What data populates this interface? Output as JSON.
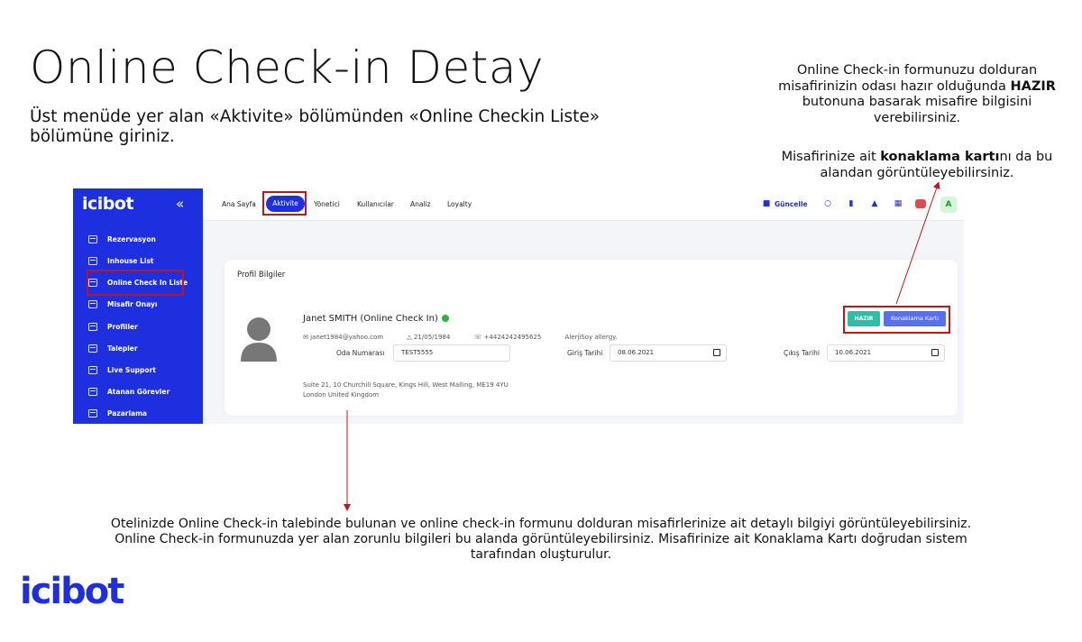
{
  "slide": {
    "title": "Online Check-in Detay",
    "subtitle": "Üst menüde yer alan «Aktivite» bölümünden «Online Checkin Liste» bölümüne giriniz.",
    "note_top_1": "Online Check-in formunuzu dolduran misafirinizin odası hazır olduğunda ",
    "note_top_bold": "HAZIR",
    "note_top_2": " butonuna basarak misafire bilgisini verebilirsiniz.",
    "note_card_1": "Misafirinize ait ",
    "note_card_bold": "konaklama kartı",
    "note_card_2": "nı da bu alandan görüntüleyebilirsiniz.",
    "note_bottom": "Otelinizde Online Check-in talebinde bulunan ve online check-in formunu dolduran misafirlerinize ait detaylı bilgiyi görüntüleyebilirsiniz. Online Check-in formunuzda yer alan zorunlu bilgileri bu alanda görüntüleyebilirsiniz. Misafirinize ait Konaklama Kartı doğrudan sistem tarafından oluşturulur.",
    "logo": "icibot"
  },
  "sidebar": {
    "logo": "icibot",
    "collapse": "«",
    "items": [
      {
        "label": "Rezervasyon"
      },
      {
        "label": "Inhouse List"
      },
      {
        "label": "Online Check In Liste"
      },
      {
        "label": "Misafir Onayı"
      },
      {
        "label": "Profiller"
      },
      {
        "label": "Talepler"
      },
      {
        "label": "Live Support"
      },
      {
        "label": "Atanan Görevler"
      },
      {
        "label": "Pazarlama"
      }
    ]
  },
  "topnav": {
    "items": [
      "Ana Sayfa",
      "Aktivite",
      "Yönetici",
      "Kullanıcılar",
      "Analiz",
      "Loyalty"
    ],
    "update_label": "Güncelle",
    "avatar_letter": "A"
  },
  "card": {
    "title": "Profil Bilgiler",
    "guest_name": "Janet SMITH (Online Check In)",
    "email": "janet1984@yahoo.com",
    "birth_date": "21/05/1984",
    "phone": "+4424242495625",
    "allergy": "AlerjiSoy allergy.",
    "room_label": "Oda Numarası",
    "room_value": "TEST5555",
    "checkin_label": "Giriş Tarihi",
    "checkin_value": "08.06.2021",
    "checkout_label": "Çıkış Tarihi",
    "checkout_value": "10.06.2021",
    "address_line1": "Suite 21, 10 Churchill Square, Kings Hill, West Malling, ME19 4YU",
    "address_line2": "London United Kingdom",
    "ready_button": "HAZIR",
    "card_button": "Konaklama Kartı"
  },
  "colors": {
    "brand_blue": "#1e2fe0",
    "highlight_red": "#c0161a",
    "ready_green": "#2bbfa8"
  }
}
